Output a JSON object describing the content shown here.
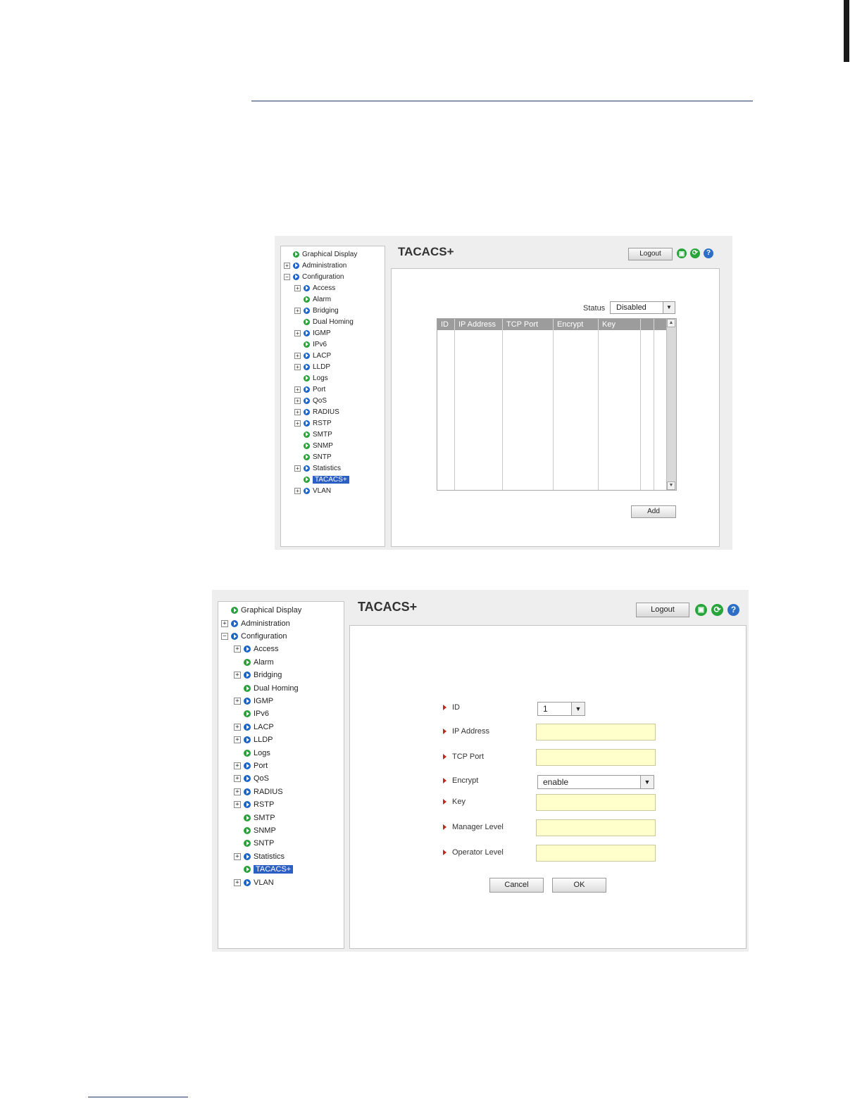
{
  "tree_items": [
    {
      "key": "graphical",
      "label": "Graphical Display",
      "level": 0,
      "expander": "none",
      "dot": "green",
      "selected": false
    },
    {
      "key": "administration",
      "label": "Administration",
      "level": 0,
      "expander": "plus",
      "dot": "blue",
      "selected": false
    },
    {
      "key": "configuration",
      "label": "Configuration",
      "level": 0,
      "expander": "minus",
      "dot": "blue",
      "selected": false
    },
    {
      "key": "access",
      "label": "Access",
      "level": 1,
      "expander": "plus",
      "dot": "blue",
      "selected": false
    },
    {
      "key": "alarm",
      "label": "Alarm",
      "level": 1,
      "expander": "none",
      "dot": "green",
      "selected": false
    },
    {
      "key": "bridging",
      "label": "Bridging",
      "level": 1,
      "expander": "plus",
      "dot": "blue",
      "selected": false
    },
    {
      "key": "dual-homing",
      "label": "Dual Homing",
      "level": 1,
      "expander": "none",
      "dot": "green",
      "selected": false
    },
    {
      "key": "igmp",
      "label": "IGMP",
      "level": 1,
      "expander": "plus",
      "dot": "blue",
      "selected": false
    },
    {
      "key": "ipv6",
      "label": "IPv6",
      "level": 1,
      "expander": "none",
      "dot": "green",
      "selected": false
    },
    {
      "key": "lacp",
      "label": "LACP",
      "level": 1,
      "expander": "plus",
      "dot": "blue",
      "selected": false
    },
    {
      "key": "lldp",
      "label": "LLDP",
      "level": 1,
      "expander": "plus",
      "dot": "blue",
      "selected": false
    },
    {
      "key": "logs",
      "label": "Logs",
      "level": 1,
      "expander": "none",
      "dot": "green",
      "selected": false
    },
    {
      "key": "port",
      "label": "Port",
      "level": 1,
      "expander": "plus",
      "dot": "blue",
      "selected": false
    },
    {
      "key": "qos",
      "label": "QoS",
      "level": 1,
      "expander": "plus",
      "dot": "blue",
      "selected": false
    },
    {
      "key": "radius",
      "label": "RADIUS",
      "level": 1,
      "expander": "plus",
      "dot": "blue",
      "selected": false
    },
    {
      "key": "rstp",
      "label": "RSTP",
      "level": 1,
      "expander": "plus",
      "dot": "blue",
      "selected": false
    },
    {
      "key": "smtp",
      "label": "SMTP",
      "level": 1,
      "expander": "none",
      "dot": "green",
      "selected": false
    },
    {
      "key": "snmp",
      "label": "SNMP",
      "level": 1,
      "expander": "none",
      "dot": "green",
      "selected": false
    },
    {
      "key": "sntp",
      "label": "SNTP",
      "level": 1,
      "expander": "none",
      "dot": "green",
      "selected": false
    },
    {
      "key": "statistics",
      "label": "Statistics",
      "level": 1,
      "expander": "plus",
      "dot": "blue",
      "selected": false
    },
    {
      "key": "tacacs",
      "label": "TACACS+",
      "level": 1,
      "expander": "none",
      "dot": "green",
      "selected": true
    },
    {
      "key": "vlan",
      "label": "VLAN",
      "level": 1,
      "expander": "plus",
      "dot": "blue",
      "selected": false
    }
  ],
  "colors": {
    "accent": "#2b5fc4",
    "field_bg": "#ffffcc",
    "required_marker": "#c0281c"
  },
  "screen1": {
    "title": "TACACS+",
    "logout_label": "Logout",
    "icons": {
      "save": "save-icon",
      "refresh": "refresh-icon",
      "help": "help-icon"
    },
    "help_glyph": "?",
    "refresh_glyph": "⟳",
    "save_glyph": "▣",
    "status_label": "Status",
    "status_value": "Disabled",
    "table_headers": [
      "ID",
      "IP Address",
      "TCP Port",
      "Encrypt",
      "Key",
      "",
      ""
    ],
    "add_label": "Add"
  },
  "screen2": {
    "title": "TACACS+",
    "logout_label": "Logout",
    "help_glyph": "?",
    "refresh_glyph": "⟳",
    "save_glyph": "▣",
    "form": {
      "id_label": "ID",
      "id_value": "1",
      "ip_label": "IP Address",
      "ip_value": "",
      "tcp_label": "TCP Port",
      "tcp_value": "",
      "encrypt_label": "Encrypt",
      "encrypt_value": "enable",
      "key_label": "Key",
      "key_value": "",
      "manager_label": "Manager Level",
      "manager_value": "",
      "operator_label": "Operator Level",
      "operator_value": ""
    },
    "cancel_label": "Cancel",
    "ok_label": "OK"
  }
}
